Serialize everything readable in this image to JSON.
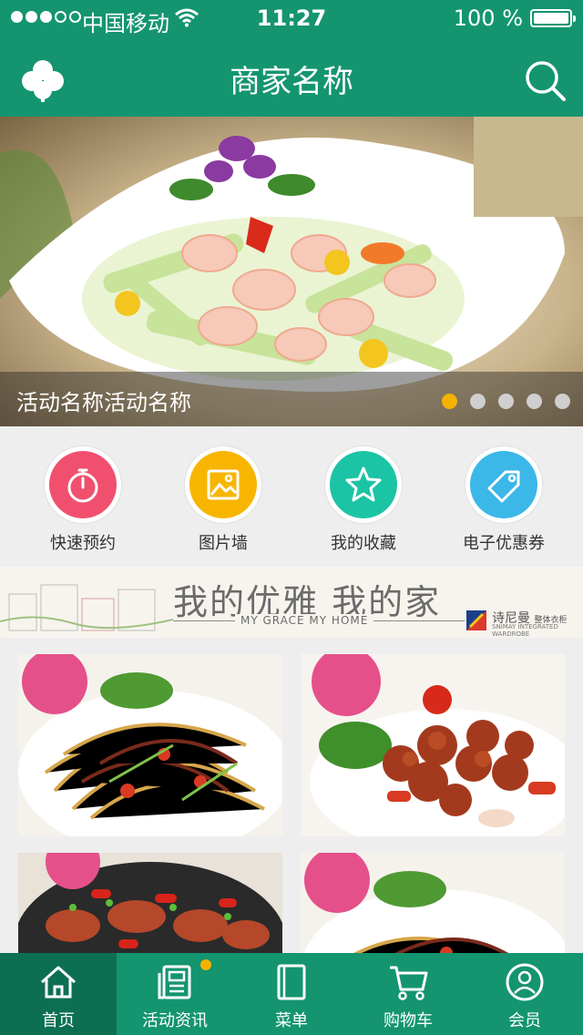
{
  "status_bar": {
    "carrier": "中国移动",
    "time": "11:27",
    "battery": "100 %",
    "signal_bars_filled": 3,
    "signal_bars_total": 5
  },
  "header": {
    "title": "商家名称",
    "logo_icon": "clover-icon",
    "search_icon": "search-icon"
  },
  "banner": {
    "caption": "活动名称活动名称",
    "page_count": 5,
    "active_page": 1
  },
  "shortcuts": [
    {
      "label": "快速预约",
      "icon": "stopwatch-icon",
      "color": "#f0506e"
    },
    {
      "label": "图片墙",
      "icon": "picture-icon",
      "color": "#f7b500"
    },
    {
      "label": "我的收藏",
      "icon": "star-icon",
      "color": "#1bc4a4"
    },
    {
      "label": "电子优惠券",
      "icon": "tag-icon",
      "color": "#3bb7e8"
    }
  ],
  "ad": {
    "title": "我的优雅 我的家",
    "subtitle": "MY GRACE MY HOME",
    "brand": "诗尼曼",
    "brand_tag": "整体衣柜",
    "brand_sub": "SNIMAY INTEGRATED WARDROBE"
  },
  "tabbar": {
    "items": [
      {
        "label": "首页",
        "icon": "home-icon",
        "active": true
      },
      {
        "label": "活动资讯",
        "icon": "news-icon",
        "badge": true
      },
      {
        "label": "菜单",
        "icon": "book-icon"
      },
      {
        "label": "购物车",
        "icon": "cart-icon"
      },
      {
        "label": "会员",
        "icon": "member-icon"
      }
    ]
  },
  "colors": {
    "brand_green": "#14956f",
    "active_tab": "#0d6f52",
    "indicator_active": "#f6b200"
  }
}
